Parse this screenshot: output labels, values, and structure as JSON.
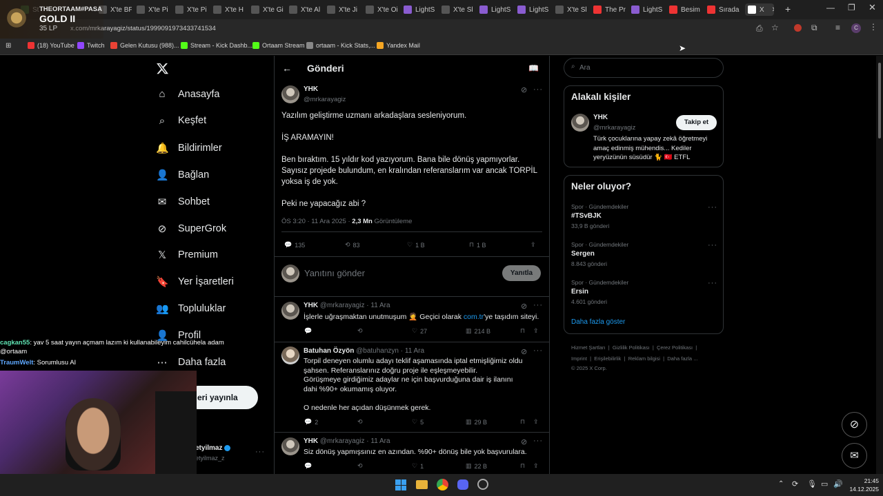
{
  "browser": {
    "tabs": [
      {
        "label": "St",
        "color": "#3a7a3a"
      },
      {
        "label": "X'te BF",
        "color": "#555"
      },
      {
        "label": "X'te Pi",
        "color": "#555"
      },
      {
        "label": "X'te Pi",
        "color": "#555"
      },
      {
        "label": "X'te H",
        "color": "#555"
      },
      {
        "label": "X'te Gi",
        "color": "#555"
      },
      {
        "label": "X'te Al",
        "color": "#555"
      },
      {
        "label": "X'te Ji",
        "color": "#555"
      },
      {
        "label": "X'te Oi",
        "color": "#555"
      },
      {
        "label": "LightS",
        "color": "#8a5cd0"
      },
      {
        "label": "X'te Sl",
        "color": "#555"
      },
      {
        "label": "LightS",
        "color": "#8a5cd0"
      },
      {
        "label": "LightS",
        "color": "#8a5cd0"
      },
      {
        "label": "X'te Sl",
        "color": "#555"
      },
      {
        "label": "The Pr",
        "color": "#e33"
      },
      {
        "label": "LightS",
        "color": "#8a5cd0"
      },
      {
        "label": "Besim",
        "color": "#e33"
      },
      {
        "label": "Sırada",
        "color": "#e33"
      },
      {
        "label": "X",
        "color": "#fff"
      }
    ],
    "url": "x.com/mrkarayagiz/status/1999091973433741534",
    "bookmarks": [
      {
        "label": "(18) YouTube",
        "color": "#e33"
      },
      {
        "label": "Twitch",
        "color": "#9146ff"
      },
      {
        "label": "Gelen Kutusu (988)...",
        "color": "#ea4335"
      },
      {
        "label": "Stream - Kick Dashb...",
        "color": "#53fc18"
      },
      {
        "label": "Ortaam Stream",
        "color": "#53fc18"
      },
      {
        "label": "ortaam - Kick Stats,...",
        "color": "#888"
      },
      {
        "label": "Yandex Mail",
        "color": "#f5a623"
      }
    ]
  },
  "overlay": {
    "rank_name": "THEORTAAM#PASA",
    "rank_tier": "GOLD II",
    "rank_lp": "35 LP",
    "chat": [
      {
        "user": "cagkan55",
        "text": ": yav 5 saat yayın açmam lazım ki kullanabileyim cahilcühela adam @ortaam"
      },
      {
        "user": "TraumWelt",
        "text": ": Sorumlusu AI"
      }
    ]
  },
  "nav": {
    "items": [
      "Anasayfa",
      "Keşfet",
      "Bildirimler",
      "Bağlan",
      "Sohbet",
      "SuperGrok",
      "Premium",
      "Yer İşaretleri",
      "Topluluklar",
      "Profil",
      "Daha fazla"
    ],
    "post_button": "eri yayınla",
    "account_name": "etyilmaz",
    "account_handle": "etyilmaz_z"
  },
  "post": {
    "header": "Gönderi",
    "author": "YHK",
    "handle": "@mrkarayagiz",
    "p1": "Yazılım geliştirme uzmanı arkadaşlara sesleniyorum.",
    "p2": "İŞ ARAMAYIN!",
    "p3": "Ben bıraktım. 15 yıldır kod yazıyorum. Bana bile dönüş yapmıyorlar. Sayısız projede bulundum, en kralından referanslarım var ancak TORPİL yoksa iş de yok.",
    "p4": "Peki ne yapacağız abi ?",
    "time": "ÖS 3:20 · 11 Ara 2025 · ",
    "views": "2,3 Mn",
    "views_label": "Görüntüleme",
    "replies": "135",
    "reposts": "83",
    "likes": "1 B",
    "bookmarks": "1 B"
  },
  "compose": {
    "placeholder": "Yanıtını gönder",
    "button": "Yanıtla"
  },
  "replies": [
    {
      "author": "YHK",
      "meta": "@mrkarayagiz · 11 Ara",
      "text_a": "İşlerle uğraşmaktan unutmuşum 🤦 Geçici olarak ",
      "link": "com.tr",
      "text_b": "'ye taşıdım siteyi.",
      "replies": "",
      "reposts": "",
      "likes": "27",
      "views": "214 B"
    },
    {
      "author": "Batuhan Özyön",
      "meta": "@batuhanzyn · 11 Ara",
      "text": "Torpil deneyen olumlu adayı teklif aşamasında iptal etmişliğimiz oldu şahsen. Referanslarınız doğru proje ile eşleşmeyebilir.\nGörüşmeye girdiğimiz adaylar ne için başvurduğuna dair iş ilanını dahi %90+ okumamış oluyor.\n\nO nedenle her açıdan düşünmek gerek.",
      "replies": "2",
      "reposts": "",
      "likes": "5",
      "views": "29 B"
    },
    {
      "author": "YHK",
      "meta": "@mrkarayagiz · 11 Ara",
      "text": "Siz dönüş yapmışsınız en azından. %90+ dönüş bile yok başvurulara.",
      "replies": "",
      "reposts": "",
      "likes": "1",
      "views": "22 B"
    }
  ],
  "sidebar": {
    "search_placeholder": "Ara",
    "related_title": "Alakalı kişiler",
    "related_name": "YHK",
    "related_handle": "@mrkarayagiz",
    "follow": "Takip et",
    "related_bio": "Türk çocuklarına yapay zekâ öğretmeyi amaç edinmiş mühendis... Kediler yeryüzünün süsüdür 🐈 🇹🇷 ETFL",
    "trends_title": "Neler oluyor?",
    "trends": [
      {
        "category": "Spor · Gündemdekiler",
        "name": "#TSvBJK",
        "count": "33,9 B gönderi"
      },
      {
        "category": "Spor · Gündemdekiler",
        "name": "Sergen",
        "count": "8.843 gönderi"
      },
      {
        "category": "Spor · Gündemdekiler",
        "name": "Ersin",
        "count": "4.601 gönderi"
      }
    ],
    "show_more": "Daha fazla göster",
    "footer1": [
      "Hizmet Şartları",
      "Gizlilik Politikası",
      "Çerez Politikası"
    ],
    "footer2": [
      "Imprint",
      "Erişilebilirlik",
      "Reklam bilgisi",
      "Daha fazla ..."
    ],
    "copyright": "© 2025 X Corp."
  },
  "taskbar": {
    "time": "21:45",
    "date": "14.12.2025"
  },
  "colors": {
    "accent": "#1d9bf0",
    "bg": "#000000",
    "border": "#2f3336",
    "muted": "#71767b"
  }
}
